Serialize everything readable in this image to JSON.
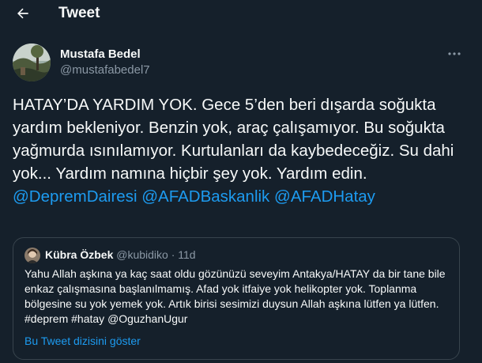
{
  "header": {
    "back_icon": "arrow-left-icon",
    "title": "Tweet"
  },
  "tweet": {
    "author": {
      "name": "Mustafa Bedel",
      "handle": "@mustafabedel7",
      "avatar": "landscape-photo-avatar"
    },
    "more_icon": "ellipsis-icon",
    "text": "HATAY’DA YARDIM YOK. Gece 5’den beri dışarda soğukta yardım bekleniyor. Benzin yok, araç çalışamıyor. Bu soğukta yağmurda ısınılamıyor. Kurtulanları da kaybedeceğiz. Su dahi yok... Yardım namına hiçbir şey yok. Yardım edin.",
    "mentions": [
      "@DepremDairesi",
      "@AFADBaskanlik",
      "@AFADHatay"
    ]
  },
  "quote": {
    "name": "Kübra Özbek",
    "handle": "@kubidiko",
    "time": "· 11d",
    "text": "Yahu Allah aşkına ya kaç saat oldu gözünüzü seveyim Antakya/HATAY da bir tane bile enkaz çalışmasına başlanılmamış. Afad yok itfaiye yok helikopter yok. Toplanma bölgesine su yok yemek yok. Artık birisi sesimizi duysun Allah aşkına lütfen ya lütfen. #deprem #hatay @OguzhanUgur",
    "thread_link": "Bu Tweet dizisini göster"
  },
  "colors": {
    "background": "#15202b",
    "text": "#f7f9f9",
    "secondary": "#8b98a5",
    "accent": "#1d9bf0",
    "border": "#38444d"
  }
}
